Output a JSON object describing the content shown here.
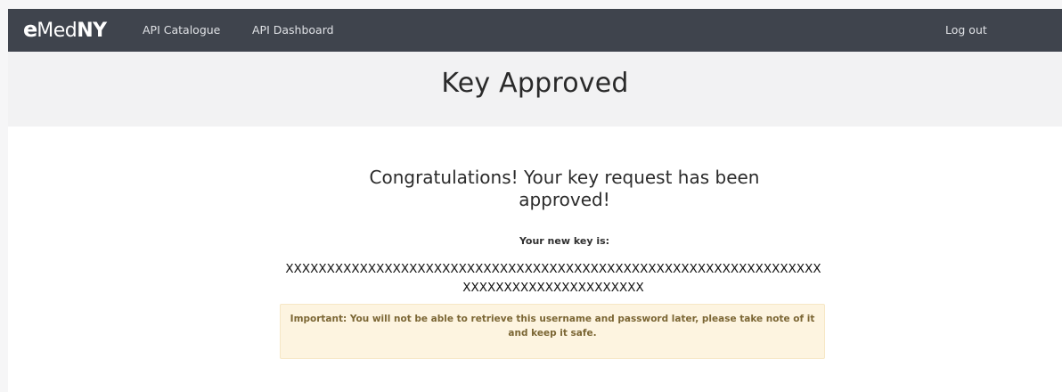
{
  "nav": {
    "logo": {
      "e": "e",
      "med": "Med",
      "ny": "NY"
    },
    "links": [
      {
        "label": "API Catalogue"
      },
      {
        "label": "API Dashboard"
      }
    ],
    "logout_label": "Log out"
  },
  "header": {
    "title": "Key Approved"
  },
  "main": {
    "congrats_text": "Congratulations! Your key request has been approved!",
    "new_key_label": "Your new key is:",
    "key_value": "XXXXXXXXXXXXXXXXXXXXXXXXXXXXXXXXXXXXXXXXXXXXXXXXXXXXXXXXXXXXXXXXXXXXXXXXXXXXXXXXXXXXXXX",
    "alert_text": "Important: You will not be able to retrieve this username and password later, please take note of it and keep it safe."
  },
  "colors": {
    "navbar": "#3f444d",
    "header_band": "#f2f2f3",
    "alert_bg": "#fdf4e0",
    "alert_text": "#7b6634"
  }
}
